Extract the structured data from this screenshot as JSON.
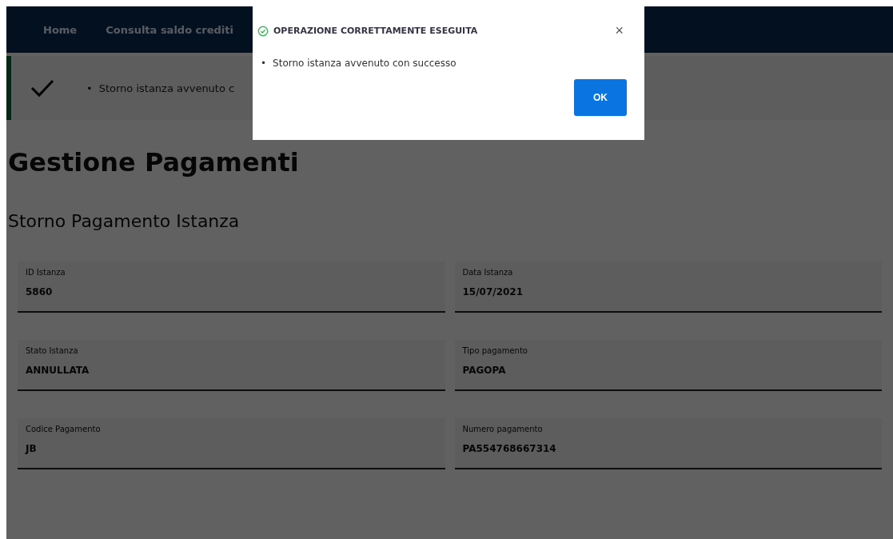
{
  "nav": {
    "items": [
      {
        "label": "Home"
      },
      {
        "label": "Consulta saldo crediti"
      }
    ]
  },
  "alert": {
    "bullet": "•",
    "message": "Storno istanza avvenuto c"
  },
  "page": {
    "title": "Gestione Pagamenti",
    "subtitle": "Storno Pagamento Istanza"
  },
  "fields": [
    {
      "label": "ID Istanza",
      "value": "5860"
    },
    {
      "label": "Data Istanza",
      "value": "15/07/2021"
    },
    {
      "label": "Stato Istanza",
      "value": "ANNULLATA"
    },
    {
      "label": "Tipo pagamento",
      "value": "PAGOPA"
    },
    {
      "label": "Codice Pagamento",
      "value": "JB"
    },
    {
      "label": "Numero pagamento",
      "value": "PA554768667314"
    }
  ],
  "dialog": {
    "title": "OPERAZIONE CORRETTAMENTE ESEGUITA",
    "close": "×",
    "messages": [
      {
        "bullet": "•",
        "text": "Storno istanza avvenuto con successo"
      }
    ],
    "button": "OK"
  }
}
